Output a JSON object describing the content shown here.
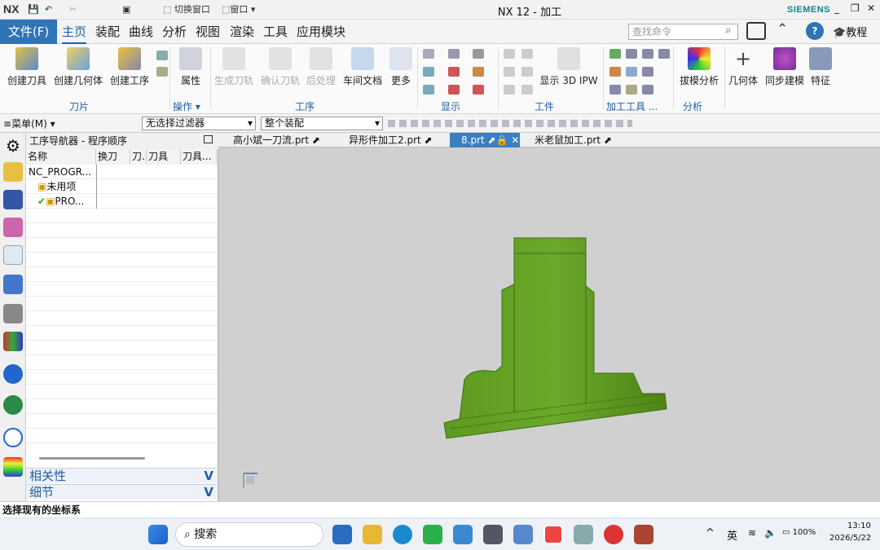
{
  "titlebar": {
    "logo": "NX",
    "quick_access": [
      "切换窗口",
      "窗口"
    ],
    "title": "NX 12 - 加工",
    "brand": "SIEMENS",
    "window_controls": [
      "_",
      "❐",
      "✕"
    ]
  },
  "menubar": {
    "file": "文件(F)",
    "tabs": [
      "主页",
      "装配",
      "曲线",
      "分析",
      "视图",
      "渲染",
      "工具",
      "应用模块"
    ],
    "active_tab": "主页",
    "search_placeholder": "查找命令",
    "tutorial": "教程"
  },
  "ribbon": {
    "buttons": {
      "create_tool": "创建刀具",
      "create_geometry": "创建几何体",
      "create_operation": "创建工序",
      "properties": "属性",
      "generate_path": "生成刀轨",
      "verify_path": "确认刀轨",
      "postprocess": "后处理",
      "shop_doc": "车间文档",
      "more": "更多",
      "show_3d_ipw": "显示 3D IPW",
      "draft_analysis": "拔模分析",
      "geometry": "几何体",
      "sync_modeling": "同步建模",
      "feature": "特征"
    },
    "groups": {
      "tool": "刀片",
      "operation": "操作",
      "procedure": "工序",
      "display": "显示",
      "workpiece": "工件",
      "machining_tools": "加工工具 ...",
      "analysis": "分析"
    }
  },
  "toolbar2": {
    "menu": "菜单(M)",
    "filter": "无选择过滤器",
    "assembly": "整个装配"
  },
  "navigator": {
    "title": "工序导航器 - 程序顺序",
    "columns": [
      "名称",
      "换刀",
      "刀.",
      "刀具",
      "刀具..."
    ],
    "rows": [
      "NC_PROGR...",
      "未用项",
      "PRO..."
    ],
    "related": "相关性",
    "details": "细节"
  },
  "file_tabs": [
    "高小斌一刀流.prt",
    "异形件加工2.prt",
    "8.prt",
    "米老鼠加工.prt"
  ],
  "active_file": "8.prt",
  "status": "选择现有的坐标系",
  "taskbar": {
    "search": "搜索",
    "lang": "英",
    "battery": "100%",
    "time": "13:10",
    "date": "2026/5/22"
  },
  "colors": {
    "accent": "#2f74b5",
    "part": "#5d9a1e",
    "viewport": "#d0d0d0"
  }
}
